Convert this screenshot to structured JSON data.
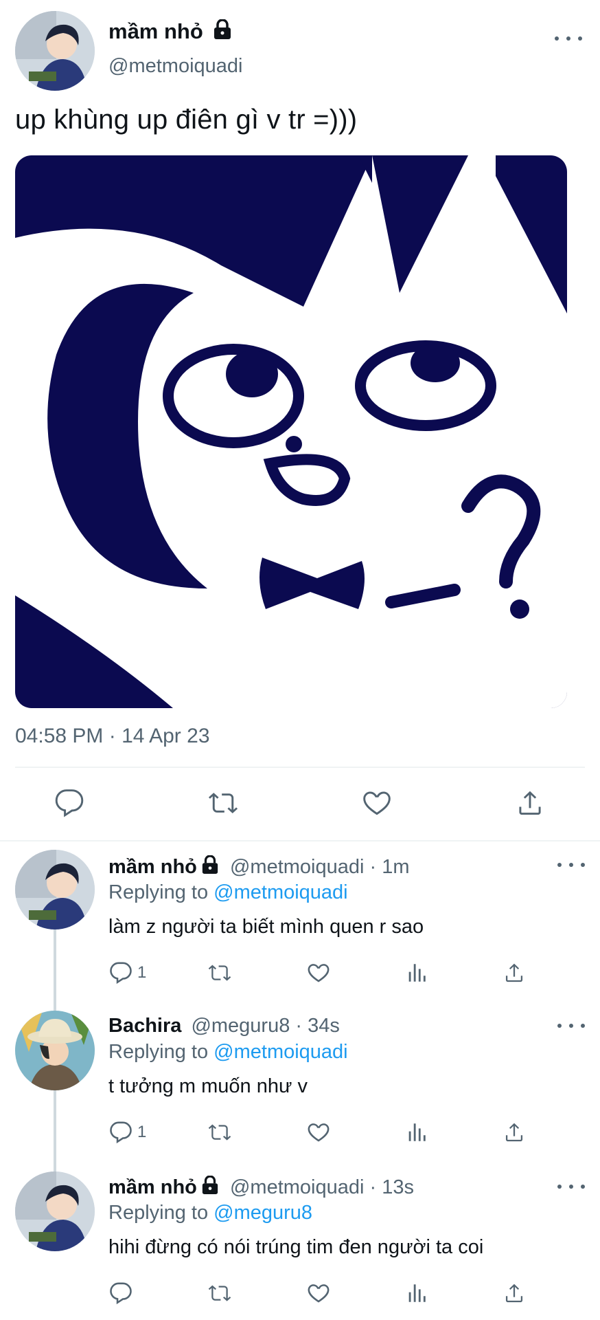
{
  "main_tweet": {
    "author_name": "mầm nhỏ",
    "handle": "@metmoiquadi",
    "text": "up khùng up điên gì v tr =)))",
    "timestamp": "04:58 PM · 14 Apr 23",
    "icons": [
      "reply-icon",
      "retweet-icon",
      "like-icon",
      "share-icon"
    ]
  },
  "replies": [
    {
      "author_name": "mầm nhỏ",
      "meta": "@metmoiquadi · 1m",
      "replying_prefix": "Replying to",
      "replying_to": "@metmoiquadi",
      "text": "làm z người ta biết mình quen r sao",
      "reply_count": "1",
      "locked": true
    },
    {
      "author_name": "Bachira",
      "meta": "@meguru8 · 34s",
      "replying_prefix": "Replying to",
      "replying_to": "@metmoiquadi",
      "text": "t tưởng m muốn như v",
      "reply_count": "1",
      "locked": false
    },
    {
      "author_name": "mầm nhỏ",
      "meta": "@metmoiquadi · 13s",
      "replying_prefix": "Replying to",
      "replying_to": "@meguru8",
      "text": "hihi đừng có nói trúng tim đen người ta coi",
      "reply_count": "",
      "locked": true
    }
  ],
  "colors": {
    "accent": "#1d9bf0",
    "text": "#0f1419",
    "muted": "#536471",
    "image_navy": "#0b0a50"
  }
}
